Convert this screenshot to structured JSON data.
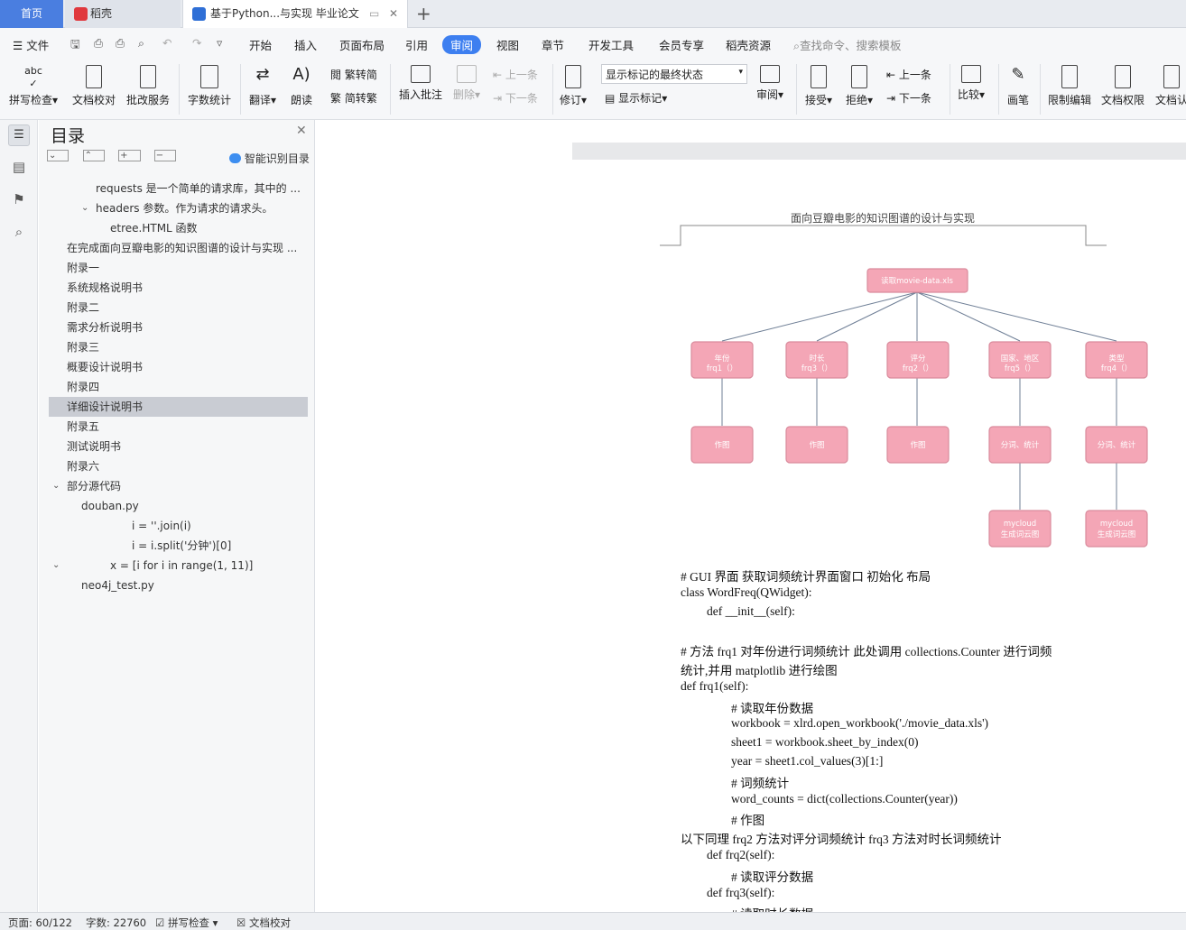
{
  "tabs": {
    "home": "首页",
    "doke": "稻壳",
    "doc": "基于Python...与实现 毕业论文"
  },
  "menu": {
    "file": "文件",
    "start": "开始",
    "insert": "插入",
    "layout": "页面布局",
    "ref": "引用",
    "review": "审阅",
    "view": "视图",
    "chapter": "章节",
    "dev": "开发工具",
    "member": "会员专享",
    "doke_res": "稻壳资源",
    "search_placeholder": "查找命令、搜索模板"
  },
  "ribbon": {
    "spell": "拼写检查",
    "proof": "文档校对",
    "correct": "批改服务",
    "wordcount": "字数统计",
    "translate": "翻译",
    "read": "朗读",
    "trad": "繁转简",
    "simp": "简转繁",
    "insert_comment": "插入批注",
    "delete": "删除",
    "prev_comment": "上一条",
    "next_comment": "下一条",
    "revise": "修订",
    "show_state": "显示标记的最终状态",
    "show_mark": "显示标记",
    "review_pane": "审阅",
    "accept": "接受",
    "reject": "拒绝",
    "prev_change": "上一条",
    "next_change": "下一条",
    "compare": "比较",
    "pen": "画笔",
    "restrict": "限制编辑",
    "perm": "文档权限",
    "auth": "文档认"
  },
  "toc": {
    "title": "目录",
    "smart": "智能识别目录",
    "items": [
      "requests 是一个简单的请求库，其中的 ...",
      "headers 参数。作为请求的请求头。",
      "etree.HTML 函数",
      "在完成面向豆瓣电影的知识图谱的设计与实现 ...",
      "附录一",
      "系统规格说明书",
      "附录二",
      "需求分析说明书",
      "附录三",
      "概要设计说明书",
      "附录四",
      "详细设计说明书",
      "附录五",
      "测试说明书",
      "附录六",
      "部分源代码",
      "douban.py",
      "i = ''.join(i)",
      "i = i.split('分钟')[0]",
      "x = [i for i in range(1, 11)]",
      "neo4j_test.py"
    ]
  },
  "document": {
    "header": "面向豆瓣电影的知识图谱的设计与实现",
    "diagram": {
      "root": "读取movie-data.xls",
      "level1": [
        {
          "title": "年份",
          "sub": "frq1（）"
        },
        {
          "title": "时长",
          "sub": "frq3（）"
        },
        {
          "title": "评分",
          "sub": "frq2（）"
        },
        {
          "title": "国家、地区",
          "sub": "frq5（）"
        },
        {
          "title": "类型",
          "sub": "frq4（）"
        }
      ],
      "level2": [
        "作图",
        "作图",
        "作图",
        "分词、统计",
        "分词、统计"
      ],
      "level3": [
        {
          "a": "mycloud",
          "b": "生成词云图"
        },
        {
          "a": "mycloud",
          "b": "生成词云图"
        }
      ]
    },
    "code": [
      "# GUI 界面  获取词频统计界面窗口  初始化  布局",
      "class WordFreq(QWidget):",
      "def __init__(self):",
      "# 方法 frq1    对年份进行词频统计  此处调用 collections.Counter 进行词频",
      "统计,并用 matplotlib 进行绘图",
      "def frq1(self):",
      "#  读取年份数据",
      "workbook = xlrd.open_workbook('./movie_data.xls')",
      "sheet1 = workbook.sheet_by_index(0)",
      "year = sheet1.col_values(3)[1:]",
      "#  词频统计",
      "word_counts = dict(collections.Counter(year))",
      "#  作图",
      "以下同理   frq2 方法对评分词频统计   frq3 方法对时长词频统计",
      "def frq2(self):",
      "#  读取评分数据",
      "def frq3(self):",
      "#  读取时长数据"
    ]
  },
  "status": {
    "page": "页面: 60/122",
    "words": "字数: 22760",
    "spell": "拼写检查",
    "proof": "文档校对"
  }
}
